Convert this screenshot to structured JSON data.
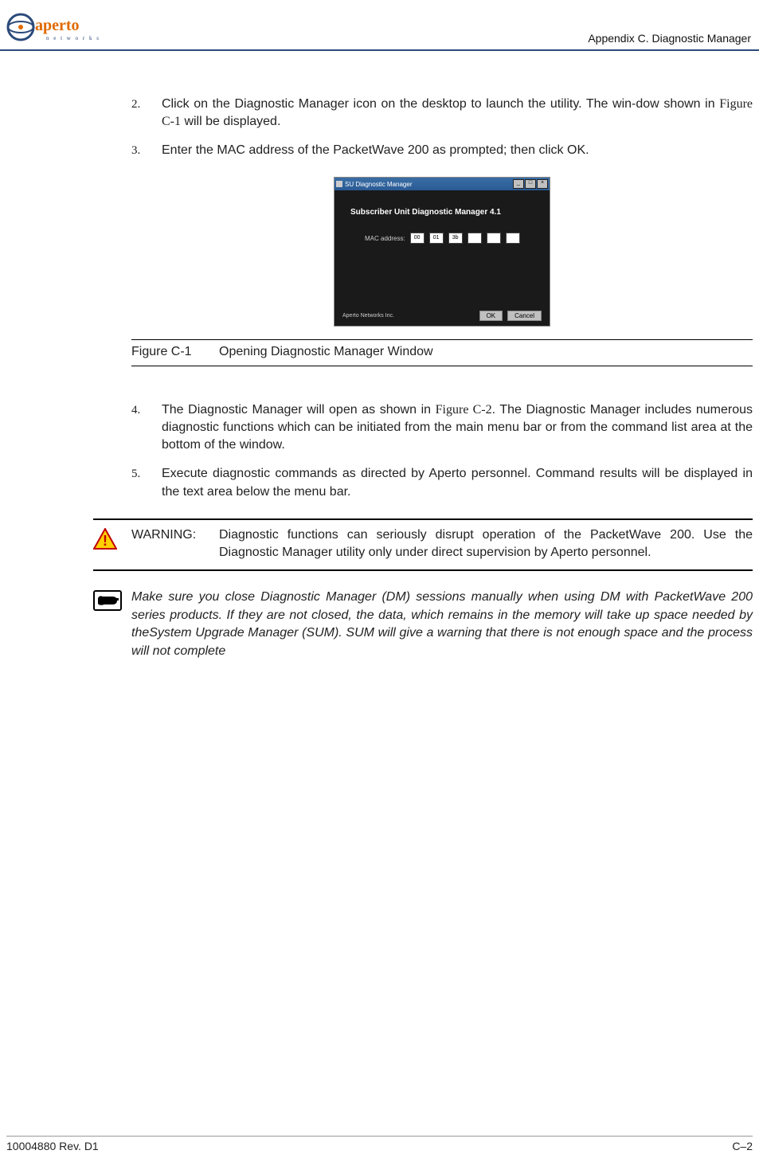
{
  "header": {
    "logo_text_main": "aperto",
    "logo_text_sub": "n e t w o r k s",
    "breadcrumb": "Appendix C.  Diagnostic Manager"
  },
  "steps": {
    "s2_num": "2.",
    "s2_part1": "Click on the Diagnostic Manager icon on the desktop to launch the utility. The win-dow shown in ",
    "s2_link": "Figure C-1",
    "s2_part2": " will be displayed.",
    "s3_num": "3.",
    "s3_text": "Enter the MAC address of the PacketWave 200 as prompted; then click OK.",
    "s4_num": "4.",
    "s4_part1": "The Diagnostic Manager will open as shown in ",
    "s4_link": "Figure C-2",
    "s4_part2": ". The Diagnostic Manager includes numerous diagnostic functions which can be initiated from the main menu bar or from the command list area at the bottom of the window.",
    "s5_num": "5.",
    "s5_text": "Execute diagnostic commands as directed by Aperto personnel. Command results will be displayed in the text area below the menu bar."
  },
  "screenshot": {
    "title": "SU Diagnostic Manager",
    "heading": "Subscriber Unit Diagnostic Manager 4.1",
    "mac_label": "MAC address:",
    "mac": [
      "00",
      "01",
      "3b",
      "",
      "",
      ""
    ],
    "vendor": "Aperto Networks Inc.",
    "ok": "OK",
    "cancel": "Cancel",
    "min": "_",
    "max": "□",
    "close": "×"
  },
  "figure": {
    "label": "Figure C-1",
    "caption": "Opening Diagnostic Manager Window"
  },
  "warning": {
    "label": "WARNING:",
    "text": "Diagnostic functions can seriously disrupt operation of the PacketWave 200. Use the Diagnostic Manager utility only under direct supervision by Aperto personnel."
  },
  "note": {
    "text": "Make sure you close Diagnostic Manager (DM) sessions manually when using DM with PacketWave 200 series products. If they are not closed, the data, which remains in the memory will take up space needed by theSystem Upgrade Manager (SUM). SUM will give a warning that there is not enough space and the process will not complete"
  },
  "footer": {
    "left": "10004880 Rev. D1",
    "right": "C–2"
  }
}
